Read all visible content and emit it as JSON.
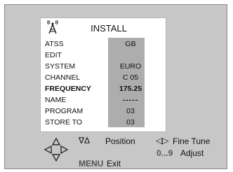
{
  "menu": {
    "title": "INSTALL",
    "rows": [
      {
        "label": "ATSS",
        "value": "GB"
      },
      {
        "label": "EDIT",
        "value": ""
      },
      {
        "label": "SYSTEM",
        "value": "EURO"
      },
      {
        "label": "CHANNEL",
        "value": "C 05"
      },
      {
        "label": "FREQUENCY",
        "value": "175.25"
      },
      {
        "label": "NAME",
        "value": "-----"
      },
      {
        "label": "PROGRAM",
        "value": "03"
      },
      {
        "label": "STORE TO",
        "value": "03"
      }
    ]
  },
  "help": {
    "position_symbol": "∇Δ",
    "position_label": "Position",
    "finetune_symbol": "◁▷",
    "finetune_label": "Fine Tune",
    "adjust_key": "0...9",
    "adjust_label": "Adjust",
    "menu_key": "MENU",
    "exit_label": "Exit"
  },
  "icons": {
    "antenna": "antenna-icon",
    "dpad": "dpad-icon"
  },
  "colors": {
    "screen_bg": "#c7c7c7",
    "menu_bg": "#ffffff",
    "value_panel": "#adadad"
  }
}
